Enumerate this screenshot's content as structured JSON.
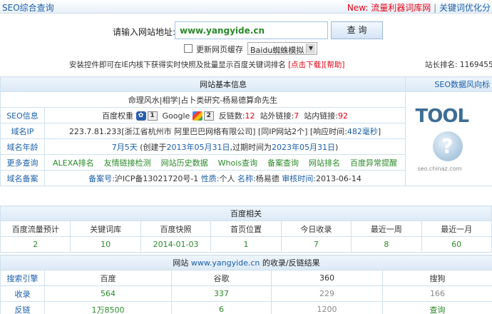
{
  "topbar": {
    "title": "SEO综合查询",
    "new_label": "New:",
    "new_link": "流量利器词库网",
    "sep": "|",
    "right_link": "关键词优化分"
  },
  "query": {
    "label": "请输入网站地址:",
    "url": "www.yangyide.cn",
    "button": "查 询"
  },
  "options": {
    "refresh_label": "更新网页缓存",
    "spider_select": "Baidu蜘蛛模拟"
  },
  "hint": {
    "text": "安装控件即可在IE内核下获得实时快照及批量显示百度关键词排名",
    "download": "[点击下载]",
    "help": "[帮助]",
    "rank_label": "站长排名:",
    "rank_value": "1169455"
  },
  "basic": {
    "header": "网站基本信息",
    "trend_link": "SEO数据风向标",
    "site_title": "命理风水|相学|占卜类研究-杨易德算命先生",
    "seo_info": {
      "label": "SEO信息",
      "baidu_weight_label": "百度权重",
      "baidu_weight": "1",
      "google_label": "Google",
      "google_pr": "2",
      "backlinks_label": "反链数:",
      "backlinks": "12",
      "external_label": "站外链接:",
      "external": "7",
      "internal_label": "站内链接:",
      "internal": "92"
    },
    "domain_ip": {
      "label": "域名IP",
      "ip": "223.7.81.233",
      "location": "[浙江省杭州市 阿里巴巴网络有限公司]",
      "same_ip": "[同IP网站2个]",
      "response_label": "[响应时间:",
      "response": "482毫秒",
      "response_end": "]"
    },
    "domain_age": {
      "label": "域名年龄",
      "age": "7月5天",
      "created_prefix": "(创建于",
      "created": "2013年05月31日",
      "expire_prefix": ",过期时间为",
      "expire": "2023年05月31日",
      "suffix": ")"
    },
    "more": {
      "label": "更多查询",
      "links": [
        "ALEXA排名",
        "友情链接检测",
        "网站历史数据",
        "Whois查询",
        "备案查询",
        "网站排名",
        "百度异常提醒"
      ]
    },
    "icp": {
      "label": "域名备案",
      "number_label": "备案号:",
      "number": "沪ICP备13021720号-1",
      "nature_label": "性质:",
      "nature": "个人",
      "name_label": "名称:",
      "name": "杨易德",
      "date_label": "审核时间:",
      "date": "2013-06-14"
    },
    "logo": {
      "word": "TOOL",
      "caption": "seo.chinaz.com"
    }
  },
  "baidu": {
    "header": "百度相关",
    "columns": [
      "百度流量预计",
      "关键词库",
      "百度快照",
      "首页位置",
      "今日收录",
      "最近一周",
      "最近一月"
    ],
    "values": [
      "2",
      "10",
      "2014-01-03",
      "1",
      "7",
      "8",
      "60"
    ]
  },
  "index": {
    "header_prefix": "网站",
    "header_site": "www.yangyide.cn",
    "header_suffix": "的收录/反链结果",
    "columns": [
      "搜索引擎",
      "百度",
      "谷歌",
      "360",
      "搜狗"
    ],
    "rows": [
      {
        "label": "收录",
        "values": [
          "564",
          "337",
          "229",
          "166"
        ]
      },
      {
        "label": "反链",
        "values": [
          "1万8500",
          "6",
          "1200",
          "查询"
        ]
      }
    ]
  },
  "colors": {
    "blue": "#1b5fa8",
    "red": "#e60012",
    "green": "#2a8a2a",
    "border": "#cfe0ee"
  }
}
